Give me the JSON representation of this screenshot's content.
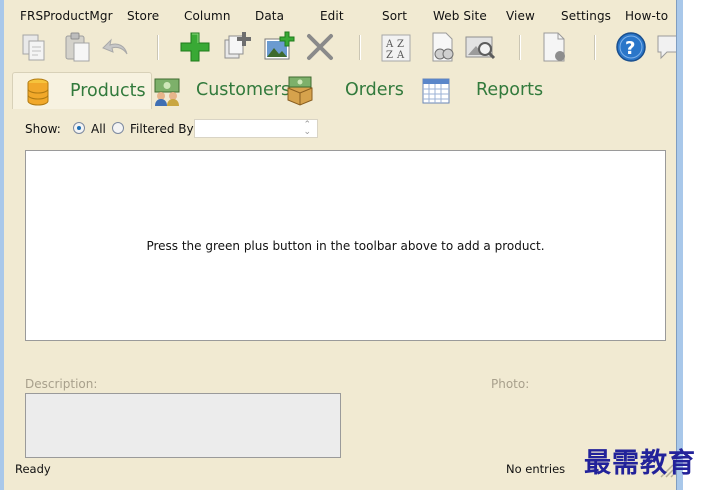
{
  "menu": [
    "FRSProductMgr",
    "Store",
    "Column",
    "Data",
    "Edit",
    "Sort",
    "Web Site",
    "View",
    "Settings",
    "How-to"
  ],
  "toolbar": {
    "icons": [
      "copy-icon",
      "paste-icon",
      "undo-icon",
      "add-product-icon",
      "duplicate-icon",
      "add-image-icon",
      "delete-icon",
      "sort-az-icon",
      "find-icon",
      "image-search-icon",
      "publish-icon",
      "help-icon",
      "feedback-icon"
    ]
  },
  "tabs": [
    {
      "label": "Products",
      "icon": "database-icon",
      "active": true
    },
    {
      "label": "Customers",
      "icon": "customers-icon",
      "active": false
    },
    {
      "label": "Orders",
      "icon": "orders-icon",
      "active": false
    },
    {
      "label": "Reports",
      "icon": "reports-icon",
      "active": false
    }
  ],
  "filter": {
    "show_label": "Show:",
    "all_label": "All",
    "filtered_label": "Filtered By",
    "selected": "all",
    "filter_value": ""
  },
  "list": {
    "empty_message": "Press the green plus button in the toolbar above to add a product."
  },
  "details": {
    "description_label": "Description:",
    "photo_label": "Photo:",
    "description_value": ""
  },
  "status": {
    "left": "Ready",
    "right": "No entries"
  },
  "watermark": "最需教育",
  "colors": {
    "tab_text": "#327a3c",
    "background": "#f1ead2",
    "accent_green": "#2f9f2f",
    "help_blue": "#2a76c9"
  }
}
